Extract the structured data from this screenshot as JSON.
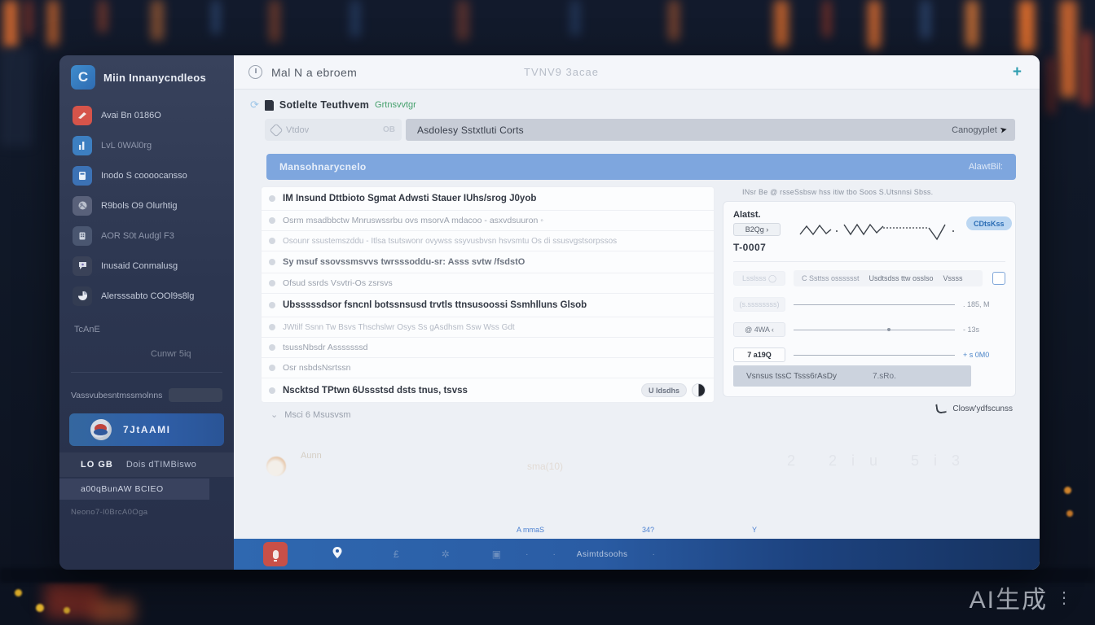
{
  "colors": {
    "accent_blue": "#3b82c6",
    "banner_blue": "#7ea6de",
    "sidebar_bg": "#2c3650",
    "danger_red": "#c85048",
    "taskbar_blue": "#2a5ca4",
    "green_accent": "#45a06c",
    "pill_blue": "#bcd7f2"
  },
  "watermark": {
    "text": "AI生成",
    "dots": "⋮"
  },
  "sidebar": {
    "header": {
      "logo": "C",
      "title": "Miin Innanycndleos"
    },
    "items": [
      {
        "label": "Avai Bn 0186O"
      },
      {
        "label": "LvL 0WAl0rg"
      },
      {
        "label": "Inodo S coooocansso"
      },
      {
        "label": "R9bols O9 Olurhtig"
      },
      {
        "label": "AOR S0t Audgl F3"
      },
      {
        "label": "Inusaid Conmalusg"
      },
      {
        "label": "Alersssabto COOl9s8lg"
      }
    ],
    "section_label": "TcAnE",
    "secondary_label": "Cunwr 5iq",
    "storage_label": "Vassvubesntmssmolnns",
    "profile": {
      "name": "7JtAAMI"
    },
    "stats_row": {
      "left": "LO GB",
      "right": "Dois dTIMBiswo"
    },
    "action_row": "a00qBunAW BCIEO",
    "footer": "Neono7-l0BrcA0Oga"
  },
  "titlebar": {
    "title": "Mal N a ebroem",
    "center_text": "TVNV9  3acae",
    "add_label": "+"
  },
  "subheader": {
    "refresh_glyph": "⟳",
    "title": "Sotlelte Teuthvem",
    "suffix": "Grtnsvvtgr"
  },
  "search": {
    "placeholder": "Vtdov",
    "badge": "OB"
  },
  "dropdown": {
    "value": "Asdolesy Sstxtluti Corts",
    "action": "Canogyplet",
    "cursor": "➤"
  },
  "banner": {
    "title": "Mansohnarycnelo",
    "action": "AlawtBil:"
  },
  "list": {
    "rows": [
      {
        "text": "IM Insund Dttbioto Sgmat Adwsti Stauer IUhs/srog J0yob"
      },
      {
        "text": "Osrm msadbbctw Mnruswssrbu ovs msorvA mdacoo - asxvdsuuron  ◦"
      },
      {
        "text": "Osounr ssustemszddu - Itlsa tsutswonr ovywss ssyvusbvsn hsvsmtu Os di ssusvgstsorpssos"
      },
      {
        "text": "Sy msuf ssovssmsvvs twrsssoddu-sr: Asss svtw /fsdstO"
      },
      {
        "text": "Ofsud ssrds Vsvtri-Os zsrsvs"
      },
      {
        "text": "Ubsssssdsor fsncnl botssnsusd trvtls ttnsusoossi Ssmhlluns Glsob"
      },
      {
        "text": "JWtilf Ssnn Tw Bsvs Thschslwr Osys Ss gAsdhsm Ssw Wss Gdt"
      },
      {
        "text": "tsussNbsdr Asssssssd"
      },
      {
        "text": "Osr nsbdsNsrtssn"
      },
      {
        "text": "Nscktsd TPtwn 6Ussstsd dsts tnus, tsvss"
      },
      {
        "text": "Msci 6 Msusvsm"
      }
    ],
    "row10_badge": "U Idsdhs",
    "chevron": "⌄"
  },
  "panel": {
    "caption": "INsr Be @ rsseSsbsw hss itiw tbo Soos S.Utsnnsi Sbss.",
    "device_label": "Alatst.",
    "device_button": "B2Qg ›",
    "device_id": "T-0007",
    "pill": "CDtsKss",
    "toolbar": {
      "item1": "C Ssttss osssssst",
      "item2": "Usdtsdss ttw osslso",
      "item3": "Vssss"
    },
    "toolbar_button": "Lsslsss ◯",
    "controls": [
      {
        "label": "(s.ssssssss)",
        "value": ". 185, M"
      },
      {
        "label": "@ 4WA ‹",
        "value": "- 13s"
      },
      {
        "label": "7 a19Q",
        "value": "+ s 0M0"
      }
    ],
    "footer_bar": {
      "left": "Vsnsus tssC Tsss6rAsDy",
      "right": "7.sRo."
    },
    "link": "Closw'ydfscunss"
  },
  "fade_zone": {
    "avatar_label": "Aunn",
    "center_text": "sma(10)",
    "right_numbers": "2  2iu  5i3",
    "links": [
      "A mmaS",
      "34?",
      "Y"
    ]
  },
  "taskbar": {
    "label": "Asimtdsoohs",
    "dot": "·"
  }
}
